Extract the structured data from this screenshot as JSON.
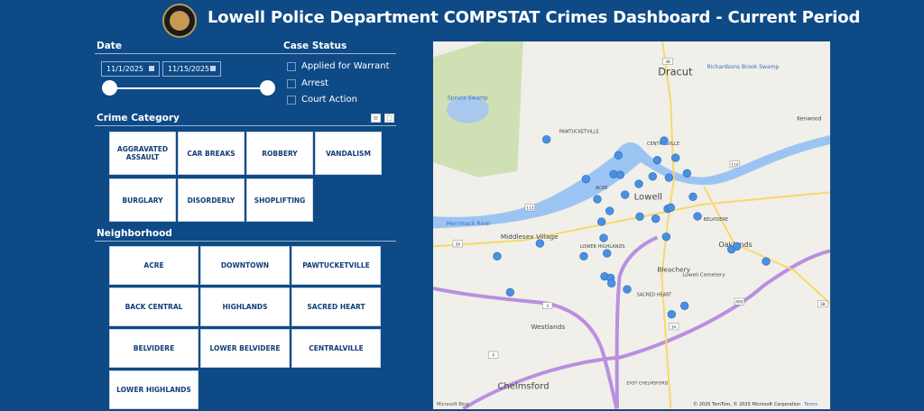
{
  "header": {
    "title": "Lowell Police Department COMPSTAT Crimes Dashboard - Current Period",
    "logo": "Lowell Police badge"
  },
  "date": {
    "label": "Date",
    "start": "11/1/2025",
    "end": "11/15/2025",
    "range_fraction": [
      0,
      1
    ]
  },
  "case_status": {
    "label": "Case Status",
    "options": [
      {
        "label": "Applied for Warrant",
        "checked": false
      },
      {
        "label": "Arrest",
        "checked": false
      },
      {
        "label": "Court Action",
        "checked": false
      }
    ]
  },
  "crime_category": {
    "label": "Crime Category",
    "items": [
      "AGGRAVATED ASSAULT",
      "CAR BREAKS",
      "ROBBERY",
      "VANDALISM",
      "BURGLARY",
      "DISORDERLY",
      "SHOPLIFTING"
    ],
    "icons": [
      "filter-icon",
      "clear-filter-icon"
    ]
  },
  "neighborhood": {
    "label": "Neighborhood",
    "items": [
      "ACRE",
      "DOWNTOWN",
      "PAWTUCKETVILLE",
      "BACK CENTRAL",
      "HIGHLANDS",
      "SACRED HEART",
      "BELVIDERE",
      "LOWER BELVIDERE",
      "CENTRALVILLE",
      "LOWER HIGHLANDS"
    ]
  },
  "map": {
    "labels": [
      "Dracut",
      "Richardsons Brook Swamp",
      "Spruce Swamp",
      "Kenwood",
      "PAWTUCKETVILLE",
      "CENTRALVILLE",
      "ACRE",
      "Lowell",
      "BELVIDERE",
      "Merrimack River",
      "Middlesex Village",
      "LOWER HIGHLANDS",
      "Oaklands",
      "Bleachery",
      "Lowell Cemetery",
      "SACRED HEART",
      "Westlands",
      "Chelmsford",
      "EAST CHELMSFORD"
    ],
    "route_shields": [
      "38",
      "110",
      "113",
      "3A",
      "3",
      "495",
      "4",
      "3A",
      "38"
    ],
    "attribution": "© 2025 TomTom, © 2025 Microsoft Corporation",
    "terms": "Terms",
    "provider": "Microsoft Bing",
    "marker_color": "#4a90e2"
  },
  "colors": {
    "background": "#0e4a86",
    "tile_text": "#123e77"
  }
}
